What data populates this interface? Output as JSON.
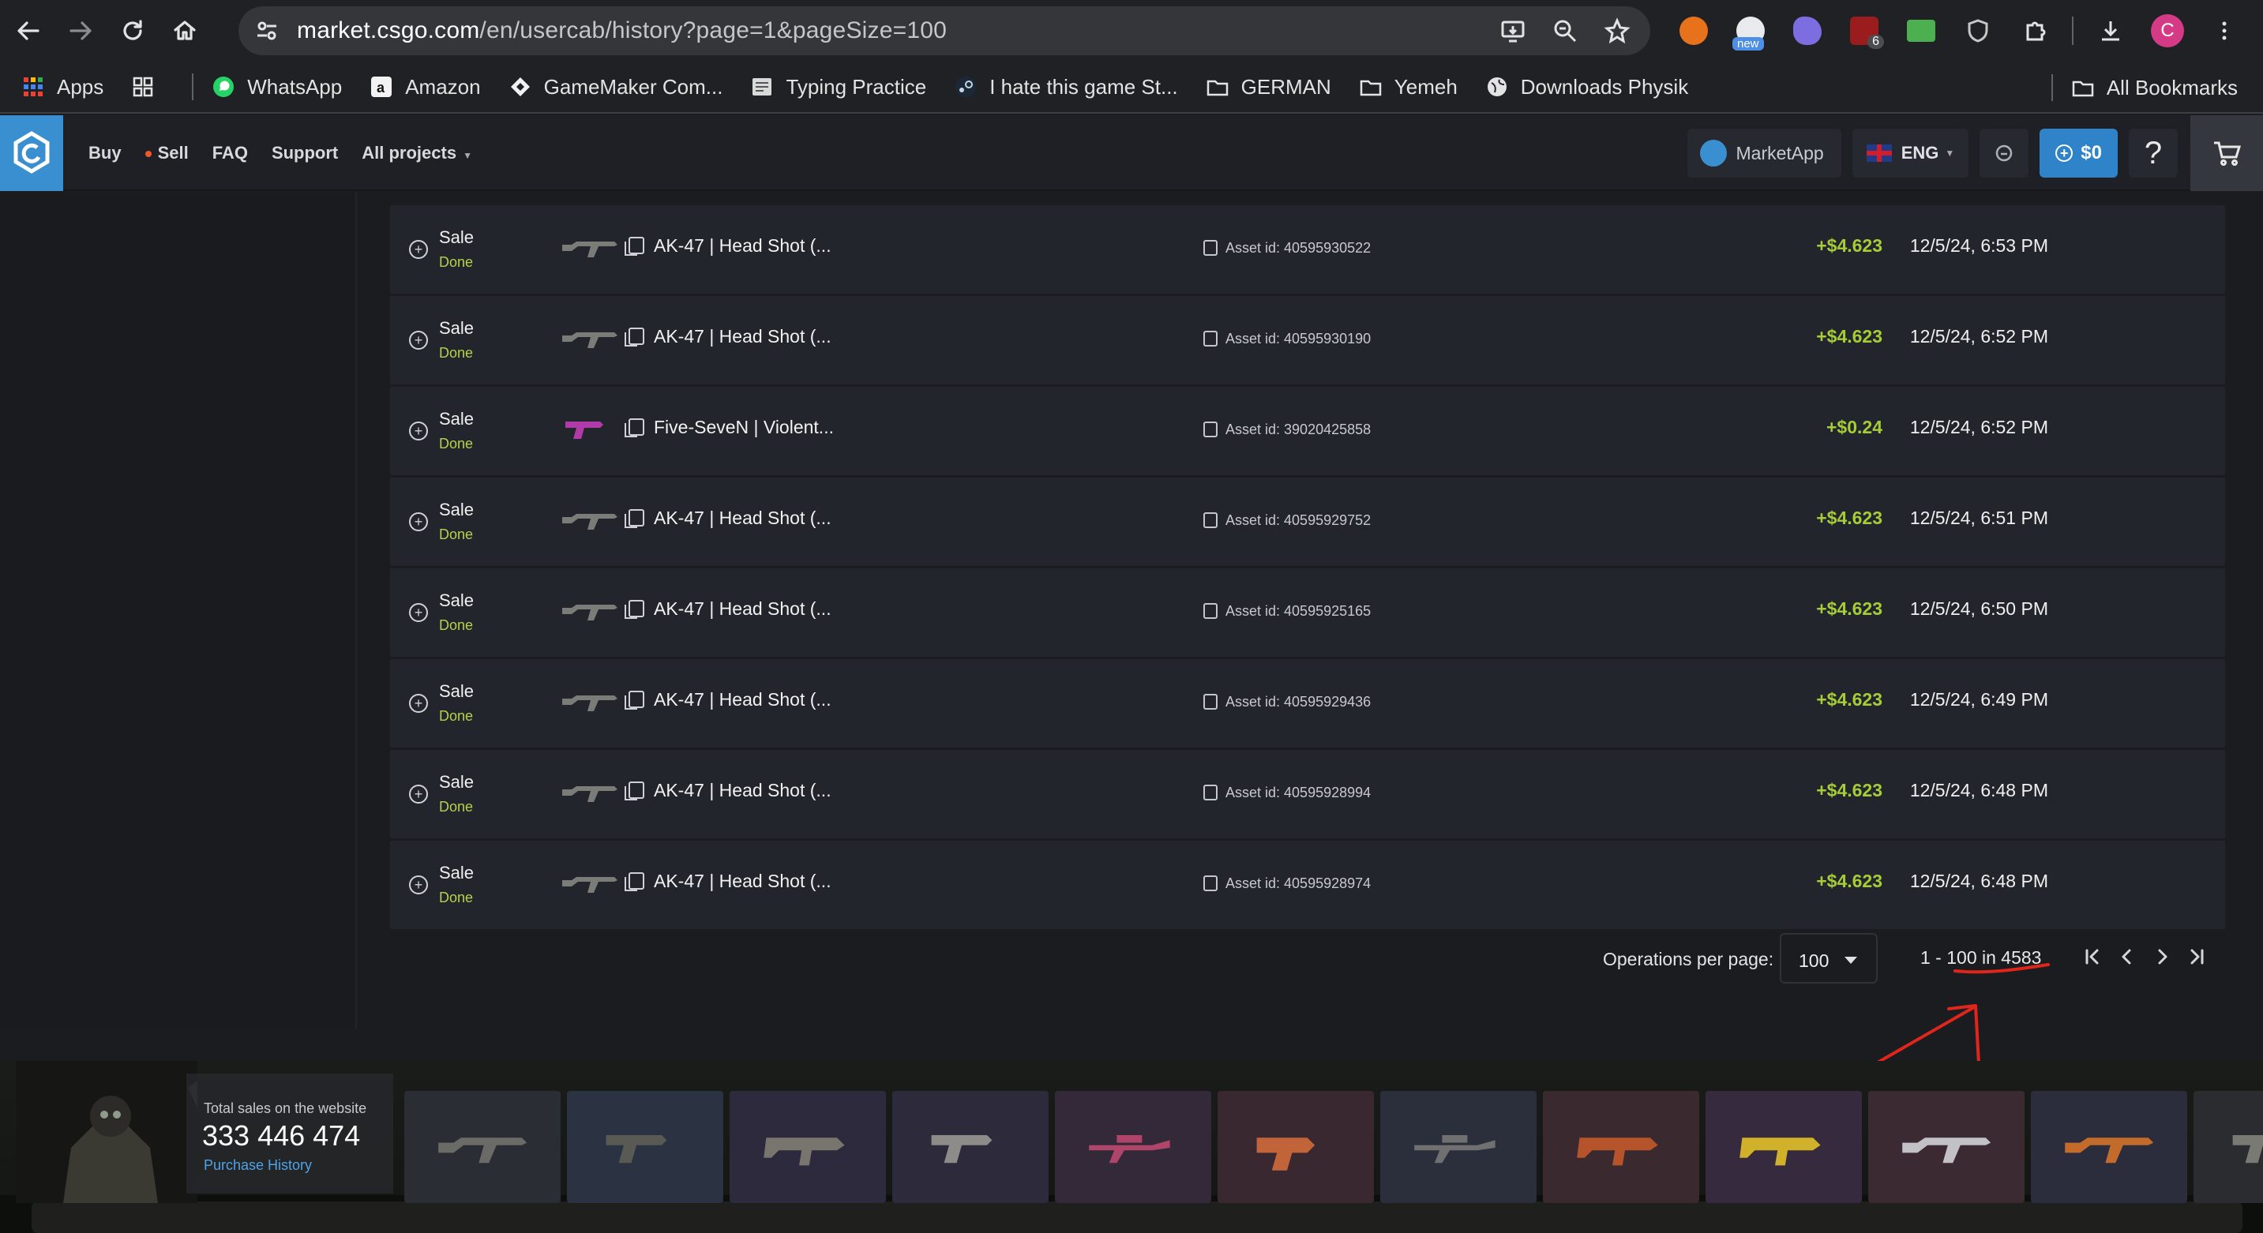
{
  "browser": {
    "url_host": "market.csgo.com",
    "url_rest": "/en/usercab/history?page=1&pageSize=100",
    "extensions": [
      {
        "name": "orange-extension",
        "color": "#e8711b"
      },
      {
        "name": "news-extension",
        "color": "#2b2f36",
        "badge": "new"
      },
      {
        "name": "purple-extension",
        "color": "#7c6ee0"
      },
      {
        "name": "ublock-extension",
        "color": "#9b1c1c",
        "badge": "6"
      },
      {
        "name": "green-glasses-extension",
        "color": "#4caf50"
      },
      {
        "name": "shield-extension",
        "color": "#9aa0a6"
      }
    ],
    "profile_initial": "C"
  },
  "bookmarks": {
    "items": [
      {
        "label": "Apps",
        "icon": "apps-grid-icon"
      },
      {
        "label": "",
        "icon": "grid-icon"
      },
      {
        "label": "WhatsApp",
        "icon": "whatsapp-icon"
      },
      {
        "label": "Amazon",
        "icon": "amazon-icon"
      },
      {
        "label": "GameMaker Com...",
        "icon": "gamemaker-icon"
      },
      {
        "label": "Typing Practice",
        "icon": "typing-icon"
      },
      {
        "label": "I hate this game St...",
        "icon": "steam-icon"
      },
      {
        "label": "GERMAN",
        "icon": "folder-icon"
      },
      {
        "label": "Yemeh",
        "icon": "folder-icon"
      },
      {
        "label": "Downloads Physik",
        "icon": "globe-icon"
      }
    ],
    "all_bookmarks": "All Bookmarks"
  },
  "site_nav": {
    "buy": "Buy",
    "sell": "Sell",
    "faq": "FAQ",
    "support": "Support",
    "all_projects": "All projects",
    "marketapp": "MarketApp",
    "lang": "ENG",
    "balance": "$0",
    "help": "?"
  },
  "rows": [
    {
      "type": "Sale",
      "status": "Done",
      "item": "AK-47 | Head Shot (...",
      "asset": "Asset id: 40595930522",
      "price": "+$4.623",
      "date": "12/5/24, 6:53 PM",
      "weapon": "rifle"
    },
    {
      "type": "Sale",
      "status": "Done",
      "item": "AK-47 | Head Shot (...",
      "asset": "Asset id: 40595930190",
      "price": "+$4.623",
      "date": "12/5/24, 6:52 PM",
      "weapon": "rifle"
    },
    {
      "type": "Sale",
      "status": "Done",
      "item": "Five-SeveN | Violent...",
      "asset": "Asset id: 39020425858",
      "price": "+$0.24",
      "date": "12/5/24, 6:52 PM",
      "weapon": "pistol"
    },
    {
      "type": "Sale",
      "status": "Done",
      "item": "AK-47 | Head Shot (...",
      "asset": "Asset id: 40595929752",
      "price": "+$4.623",
      "date": "12/5/24, 6:51 PM",
      "weapon": "rifle"
    },
    {
      "type": "Sale",
      "status": "Done",
      "item": "AK-47 | Head Shot (...",
      "asset": "Asset id: 40595925165",
      "price": "+$4.623",
      "date": "12/5/24, 6:50 PM",
      "weapon": "rifle"
    },
    {
      "type": "Sale",
      "status": "Done",
      "item": "AK-47 | Head Shot (...",
      "asset": "Asset id: 40595929436",
      "price": "+$4.623",
      "date": "12/5/24, 6:49 PM",
      "weapon": "rifle"
    },
    {
      "type": "Sale",
      "status": "Done",
      "item": "AK-47 | Head Shot (...",
      "asset": "Asset id: 40595928994",
      "price": "+$4.623",
      "date": "12/5/24, 6:48 PM",
      "weapon": "rifle"
    },
    {
      "type": "Sale",
      "status": "Done",
      "item": "AK-47 | Head Shot (...",
      "asset": "Asset id: 40595928974",
      "price": "+$4.623",
      "date": "12/5/24, 6:48 PM",
      "weapon": "rifle"
    }
  ],
  "pagination": {
    "label": "Operations per page:",
    "per_page": "100",
    "range": "1 - 100 in 4583"
  },
  "footer": {
    "total_label": "Total sales on the website",
    "total_value": "333 446 474",
    "history_link": "Purchase History",
    "cards": [
      {
        "kind": "rifle",
        "bg": "#2a2d33"
      },
      {
        "kind": "pistol",
        "bg": "#2b3242"
      },
      {
        "kind": "smg",
        "bg": "#2e2a3d"
      },
      {
        "kind": "pistol",
        "bg": "#2d2a3c"
      },
      {
        "kind": "sniper",
        "bg": "#332938"
      },
      {
        "kind": "revolver",
        "bg": "#3a2830"
      },
      {
        "kind": "sniper",
        "bg": "#2b2f3b"
      },
      {
        "kind": "smg",
        "bg": "#3a2a30"
      },
      {
        "kind": "smg",
        "bg": "#352a3e"
      },
      {
        "kind": "rifle",
        "bg": "#3b2a32"
      },
      {
        "kind": "rifle",
        "bg": "#2c2d3c"
      },
      {
        "kind": "pistol",
        "bg": "#2a2c2f"
      }
    ]
  },
  "colors": {
    "accent_blue": "#2f83c8",
    "price_green": "#a6cc37",
    "status_green": "#b6d24b",
    "annotation_red": "#e0251b"
  }
}
